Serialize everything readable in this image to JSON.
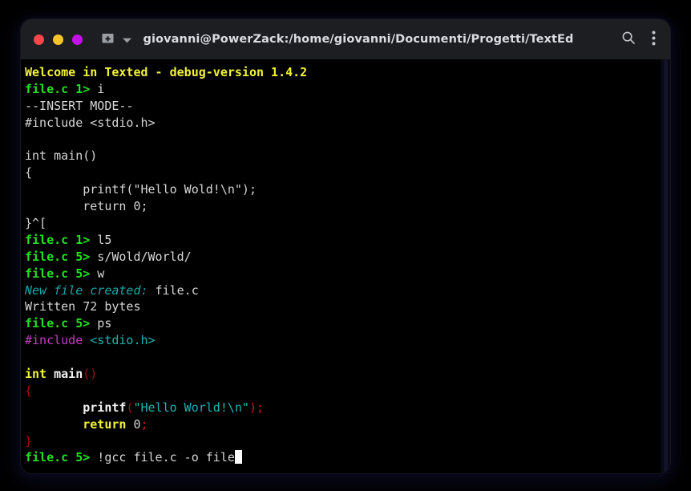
{
  "window": {
    "title": "giovanni@PowerZack:/home/giovanni/Documenti/Progetti/TextEd",
    "controls": {
      "close_label": "close-window",
      "minimize_label": "minimize-window",
      "maximize_label": "maximize-window"
    },
    "new_tab_label": "new-tab",
    "dropdown_label": "tab-dropdown",
    "search_label": "search",
    "menu_label": "menu",
    "colors": {
      "close_dot": "#f9464b",
      "minimize_dot": "#f7c52b",
      "maximize_dot": "#c312e8",
      "titlebar_bg": "#1c1e22",
      "terminal_bg": "#000000",
      "prompt_green": "#22e022",
      "banner_yellow": "#f2f23a",
      "info_cyan": "#17a8a8",
      "keyword_yellow": "#f2f23a",
      "preproc_magenta": "#c03ec0",
      "punct_red": "#a01010",
      "string_cyan": "#1ab5b5"
    }
  },
  "terminal": {
    "lines": [
      {
        "id": "banner",
        "segments": [
          {
            "text": "Welcome in Texted - debug-version 1.4.2",
            "style": "c-yellow"
          }
        ]
      },
      {
        "id": "cmd-insert",
        "segments": [
          {
            "text": "file.c 1>",
            "style": "c-green"
          },
          {
            "text": " i",
            "style": "c-white"
          }
        ]
      },
      {
        "id": "insert-mode",
        "segments": [
          {
            "text": "--INSERT MODE--",
            "style": "c-white"
          }
        ]
      },
      {
        "id": "edit-include",
        "segments": [
          {
            "text": "#include <stdio.h>",
            "style": "c-white"
          }
        ]
      },
      {
        "id": "edit-blank-1",
        "segments": [
          {
            "text": "",
            "style": "c-white"
          }
        ]
      },
      {
        "id": "edit-main",
        "segments": [
          {
            "text": "int main()",
            "style": "c-white"
          }
        ]
      },
      {
        "id": "edit-open-brace",
        "segments": [
          {
            "text": "{",
            "style": "c-white"
          }
        ]
      },
      {
        "id": "edit-printf",
        "segments": [
          {
            "text": "        printf(\"Hello Wold!\\n\");",
            "style": "c-white"
          }
        ]
      },
      {
        "id": "edit-return",
        "segments": [
          {
            "text": "        return 0;",
            "style": "c-white"
          }
        ]
      },
      {
        "id": "edit-close-brace",
        "segments": [
          {
            "text": "}^[",
            "style": "c-white"
          }
        ]
      },
      {
        "id": "cmd-l5",
        "segments": [
          {
            "text": "file.c 1>",
            "style": "c-green"
          },
          {
            "text": " l5",
            "style": "c-white"
          }
        ]
      },
      {
        "id": "cmd-sub",
        "segments": [
          {
            "text": "file.c 5>",
            "style": "c-green"
          },
          {
            "text": " s/Wold/World/",
            "style": "c-white"
          }
        ]
      },
      {
        "id": "cmd-write",
        "segments": [
          {
            "text": "file.c 5>",
            "style": "c-green"
          },
          {
            "text": " w",
            "style": "c-white"
          }
        ]
      },
      {
        "id": "out-new-file",
        "segments": [
          {
            "text": "New file created:",
            "style": "c-cyan-i"
          },
          {
            "text": " file.c",
            "style": "c-white"
          }
        ]
      },
      {
        "id": "out-written",
        "segments": [
          {
            "text": "Written 72 bytes",
            "style": "c-white"
          }
        ]
      },
      {
        "id": "cmd-ps",
        "segments": [
          {
            "text": "file.c 5>",
            "style": "c-green"
          },
          {
            "text": " ps",
            "style": "c-white"
          }
        ]
      },
      {
        "id": "hl-include",
        "segments": [
          {
            "text": "#include",
            "style": "c-magenta"
          },
          {
            "text": " ",
            "style": "c-white"
          },
          {
            "text": "<stdio.h>",
            "style": "c-cyanstr"
          }
        ]
      },
      {
        "id": "hl-blank-1",
        "segments": [
          {
            "text": "",
            "style": "c-white"
          }
        ]
      },
      {
        "id": "hl-main",
        "segments": [
          {
            "text": "int",
            "style": "c-yellow"
          },
          {
            "text": " ",
            "style": "c-white"
          },
          {
            "text": "main",
            "style": "c-brwhite"
          },
          {
            "text": "()",
            "style": "c-dred"
          }
        ]
      },
      {
        "id": "hl-open-brace",
        "segments": [
          {
            "text": "{",
            "style": "c-dred"
          }
        ]
      },
      {
        "id": "hl-printf",
        "segments": [
          {
            "text": "        ",
            "style": "c-white"
          },
          {
            "text": "printf",
            "style": "c-brwhite"
          },
          {
            "text": "(",
            "style": "c-dred"
          },
          {
            "text": "\"Hello World!\\n\"",
            "style": "c-cyanstr"
          },
          {
            "text": ");",
            "style": "c-red"
          }
        ]
      },
      {
        "id": "hl-return",
        "segments": [
          {
            "text": "        ",
            "style": "c-white"
          },
          {
            "text": "return",
            "style": "c-yellow"
          },
          {
            "text": " ",
            "style": "c-white"
          },
          {
            "text": "0",
            "style": "c-white"
          },
          {
            "text": ";",
            "style": "c-red"
          }
        ]
      },
      {
        "id": "hl-close-brace",
        "segments": [
          {
            "text": "}",
            "style": "c-dred"
          }
        ]
      },
      {
        "id": "cmd-gcc",
        "segments": [
          {
            "text": "file.c 5>",
            "style": "c-green"
          },
          {
            "text": " !gcc file.c -o file",
            "style": "c-white"
          },
          {
            "text": "",
            "style": "cursor"
          }
        ]
      }
    ]
  }
}
